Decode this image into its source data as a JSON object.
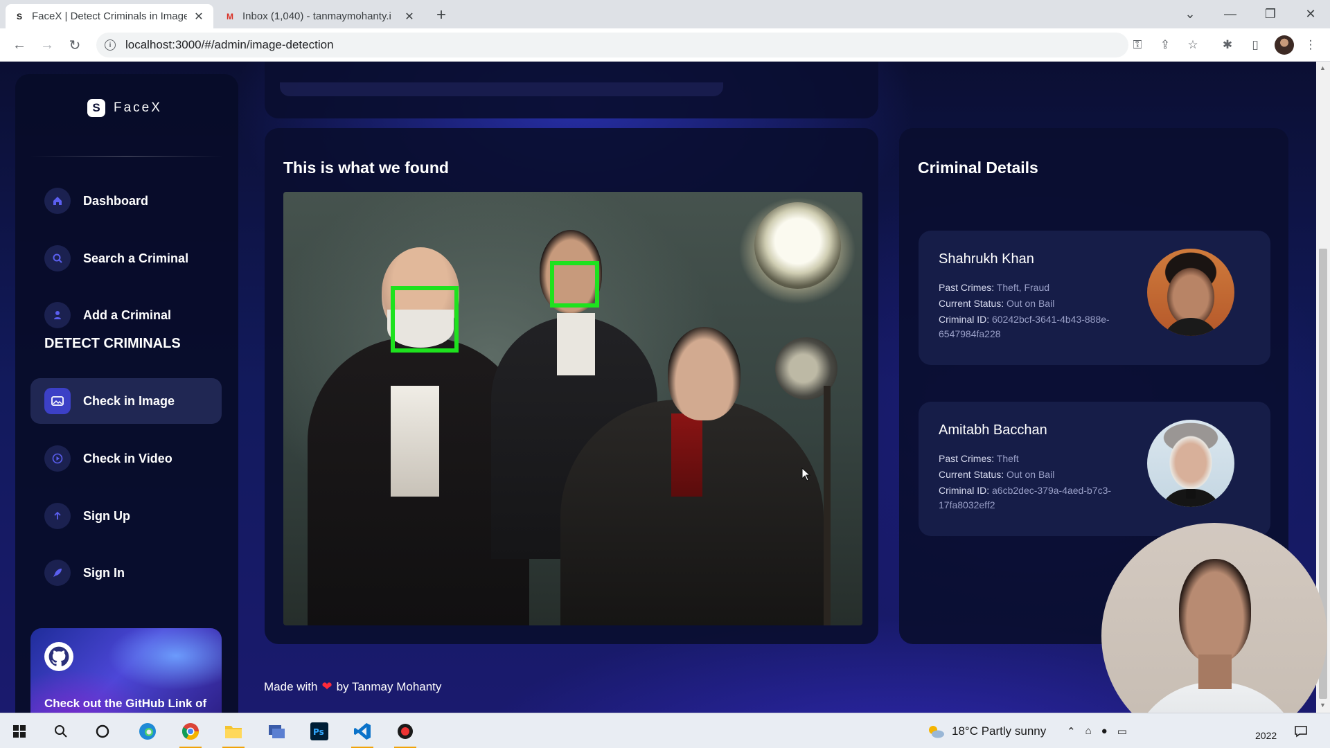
{
  "browser": {
    "tabs": [
      {
        "title": "FaceX | Detect Criminals in Image",
        "favicon": "S"
      },
      {
        "title": "Inbox (1,040) - tanmaymohanty.i",
        "favicon": "M"
      }
    ],
    "url": "localhost:3000/#/admin/image-detection"
  },
  "brand": {
    "logo_letter": "S",
    "name": "FaceX"
  },
  "sidebar": {
    "items": [
      {
        "label": "Dashboard",
        "icon": "home-icon"
      },
      {
        "label": "Search a Criminal",
        "icon": "search-icon"
      },
      {
        "label": "Add a Criminal",
        "icon": "user-icon"
      }
    ],
    "section_title": "DETECT CRIMINALS",
    "detect_items": [
      {
        "label": "Check in Image",
        "icon": "image-icon",
        "active": true
      },
      {
        "label": "Check in Video",
        "icon": "play-icon"
      },
      {
        "label": "Sign Up",
        "icon": "arrow-up-icon"
      },
      {
        "label": "Sign In",
        "icon": "rocket-icon"
      }
    ],
    "github_card": {
      "text": "Check out the GitHub Link of the Project"
    }
  },
  "found": {
    "title": "This is what we found"
  },
  "details": {
    "title": "Criminal Details",
    "criminals": [
      {
        "name": "Shahrukh Khan",
        "past_crimes_label": "Past Crimes:",
        "past_crimes": "Theft, Fraud",
        "status_label": "Current Status:",
        "status": "Out on Bail",
        "id_label": "Criminal ID:",
        "id": "60242bcf-3641-4b43-888e-6547984fa228"
      },
      {
        "name": "Amitabh Bacchan",
        "past_crimes_label": "Past Crimes:",
        "past_crimes": "Theft",
        "status_label": "Current Status:",
        "status": "Out on Bail",
        "id_label": "Criminal ID:",
        "id": "a6cb2dec-379a-4aed-b7c3-17fa8032eff2"
      }
    ]
  },
  "footer": {
    "made_with": "Made with",
    "by": "by Tanmay Mohanty"
  },
  "taskbar": {
    "weather": "18°C  Partly sunny",
    "clock_year": "2022"
  },
  "colors": {
    "accent": "#3c40c6",
    "detection_box": "#1ee21e",
    "heart": "#ff2a3a"
  }
}
